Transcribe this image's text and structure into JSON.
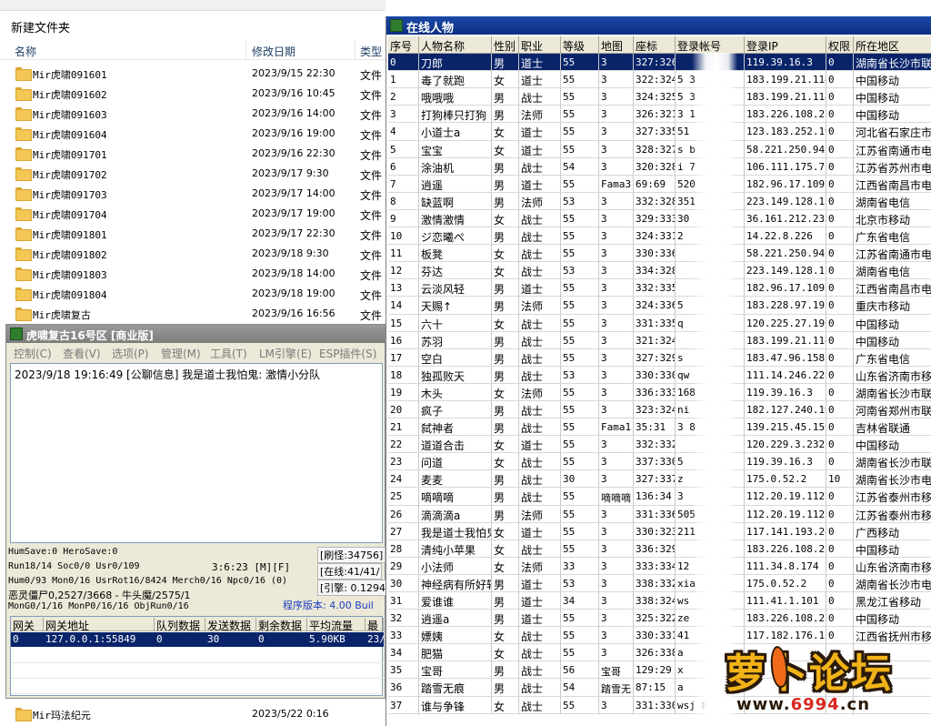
{
  "explorer": {
    "new_folder": "新建文件夹",
    "columns": {
      "name": "名称",
      "date": "修改日期",
      "type": "类型"
    },
    "files": [
      {
        "name": "Mir虎啸091601",
        "date": "2023/9/15 22:30",
        "type": "文件"
      },
      {
        "name": "Mir虎啸091602",
        "date": "2023/9/16 10:45",
        "type": "文件"
      },
      {
        "name": "Mir虎啸091603",
        "date": "2023/9/16 14:00",
        "type": "文件"
      },
      {
        "name": "Mir虎啸091604",
        "date": "2023/9/16 19:00",
        "type": "文件"
      },
      {
        "name": "Mir虎啸091701",
        "date": "2023/9/16 22:30",
        "type": "文件"
      },
      {
        "name": "Mir虎啸091702",
        "date": "2023/9/17 9:30",
        "type": "文件"
      },
      {
        "name": "Mir虎啸091703",
        "date": "2023/9/17 14:00",
        "type": "文件"
      },
      {
        "name": "Mir虎啸091704",
        "date": "2023/9/17 19:00",
        "type": "文件"
      },
      {
        "name": "Mir虎啸091801",
        "date": "2023/9/17 22:30",
        "type": "文件"
      },
      {
        "name": "Mir虎啸091802",
        "date": "2023/9/18 9:30",
        "type": "文件"
      },
      {
        "name": "Mir虎啸091803",
        "date": "2023/9/18 14:00",
        "type": "文件"
      },
      {
        "name": "Mir虎啸091804",
        "date": "2023/9/18 19:00",
        "type": "文件"
      },
      {
        "name": "Mir虎啸复古",
        "date": "2023/9/16 16:56",
        "type": "文件"
      }
    ],
    "last_row": {
      "name": "Mir玛法纪元",
      "date": "2023/5/22 0:16"
    }
  },
  "server": {
    "title": "虎啸复古16号区 [商业版]",
    "menu": [
      "控制(C)",
      "查看(V)",
      "选项(P)",
      "管理(M)",
      "工具(T)",
      "LM引擎(E)",
      "ESP插件(S)"
    ],
    "log": "2023/9/18 19:16:49 [公聊信息] 我是道士我怕鬼: 激情小分队",
    "stats": {
      "line1": "HumSave:0 HeroSave:0",
      "line2": "Run18/14 Soc0/0 Usr0/109",
      "time": "3:6:23 [M][F]",
      "line3": "Hum0/93 Mon0/16 UsrRot16/8424 Merch0/16 Npc0/16 (0)",
      "line4": "恶灵僵尸0,2527/3668 - 牛头魔/2575/1",
      "line5": "MonG0/1/16 MonP0/16/16 ObjRun0/16",
      "brush": "[刷怪:34756]",
      "online": "[在线:41/41/",
      "engine": "[引擎: 0.1294",
      "version": "程序版本: 4.00 Buil"
    },
    "gateway": {
      "headers": [
        "网关",
        "网关地址",
        "队列数据",
        "发送数据",
        "剩余数据",
        "平均流量",
        "最高"
      ],
      "row": [
        "0",
        "127.0.0.1:55849",
        "0",
        "30",
        "0",
        "5.90KB",
        "23/2"
      ]
    }
  },
  "online": {
    "title": "在线人物",
    "headers": [
      "序号",
      "人物名称",
      "性别",
      "职业",
      "等级",
      "地图",
      "座标",
      "登录帐号",
      "登录IP",
      "权限",
      "所在地区"
    ],
    "rows": [
      [
        "0",
        "刀郎",
        "男",
        "道士",
        "55",
        "3",
        "327:326",
        "",
        "119.39.16.3",
        "0",
        "湖南省长沙市联"
      ],
      [
        "1",
        "毒了就跑",
        "女",
        "道士",
        "55",
        "3",
        "322:324",
        "5 3",
        "183.199.21.114",
        "0",
        "中国移动"
      ],
      [
        "2",
        "哦哦哦",
        "男",
        "战士",
        "55",
        "3",
        "324:325",
        "5 3",
        "183.199.21.114",
        "0",
        "中国移动"
      ],
      [
        "3",
        "打狗棒只打狗",
        "男",
        "法师",
        "55",
        "3",
        "326:321",
        "3 1",
        "183.226.108.251",
        "0",
        "中国移动"
      ],
      [
        "4",
        "小道士a",
        "女",
        "道士",
        "55",
        "3",
        "327:335",
        "51",
        "123.183.252.190",
        "0",
        "河北省石家庄市"
      ],
      [
        "5",
        "宝宝",
        "女",
        "道士",
        "55",
        "3",
        "328:327",
        "s b",
        "58.221.250.94",
        "0",
        "江苏省南通市电"
      ],
      [
        "6",
        "涂油机",
        "男",
        "战士",
        "54",
        "3",
        "320:328",
        "i 7",
        "106.111.175.7",
        "0",
        "江苏省苏州市电"
      ],
      [
        "7",
        "逍遥",
        "男",
        "道士",
        "55",
        "Fama3",
        "69:69",
        "520",
        "182.96.17.109",
        "0",
        "江西省南昌市电"
      ],
      [
        "8",
        "缺蓝啊",
        "男",
        "法师",
        "53",
        "3",
        "332:328",
        "351",
        "223.149.128.129",
        "0",
        "湖南省电信"
      ],
      [
        "9",
        "激情激情",
        "女",
        "战士",
        "55",
        "3",
        "329:333",
        "30",
        "36.161.212.232",
        "0",
        "北京市移动"
      ],
      [
        "10",
        "ジ恋曦ぺ",
        "男",
        "战士",
        "55",
        "3",
        "324:331",
        "2",
        "14.22.8.226",
        "0",
        "广东省电信"
      ],
      [
        "11",
        "板凳",
        "女",
        "战士",
        "55",
        "3",
        "330:336",
        "",
        "58.221.250.94",
        "0",
        "江苏省南通市电"
      ],
      [
        "12",
        "芬达",
        "女",
        "战士",
        "53",
        "3",
        "334:328",
        "",
        "223.149.128.129",
        "0",
        "湖南省电信"
      ],
      [
        "13",
        "云淡风轻",
        "男",
        "道士",
        "55",
        "3",
        "332:335",
        "",
        "182.96.17.109",
        "0",
        "江西省南昌市电"
      ],
      [
        "14",
        "天赐↑",
        "男",
        "法师",
        "55",
        "3",
        "324:336",
        "5",
        "183.228.97.192",
        "0",
        "重庆市移动"
      ],
      [
        "15",
        "六十",
        "女",
        "战士",
        "55",
        "3",
        "331:335",
        "q",
        "120.225.27.190",
        "0",
        "中国移动"
      ],
      [
        "16",
        "苏羽",
        "男",
        "战士",
        "55",
        "3",
        "321:324",
        "",
        "183.199.21.114",
        "0",
        "中国移动"
      ],
      [
        "17",
        "空白",
        "男",
        "战士",
        "55",
        "3",
        "327:329",
        "s",
        "183.47.96.158",
        "0",
        "广东省电信"
      ],
      [
        "18",
        "独孤败天",
        "男",
        "战士",
        "53",
        "3",
        "330:330",
        "qw",
        "111.14.246.228",
        "0",
        "山东省济南市移"
      ],
      [
        "19",
        "木头",
        "女",
        "法师",
        "55",
        "3",
        "336:333",
        "168",
        "119.39.16.3",
        "0",
        "湖南省长沙市联"
      ],
      [
        "20",
        "疯子",
        "男",
        "战士",
        "55",
        "3",
        "323:324",
        "ni",
        "182.127.240.192",
        "0",
        "河南省郑州市联"
      ],
      [
        "21",
        "弑神者",
        "男",
        "战士",
        "55",
        "Fama1",
        "35:31",
        "3 8",
        "139.215.45.156",
        "0",
        "吉林省联通"
      ],
      [
        "22",
        "道道合击",
        "女",
        "道士",
        "55",
        "3",
        "332:332",
        "",
        "120.229.3.232",
        "0",
        "中国移动"
      ],
      [
        "23",
        "问道",
        "女",
        "战士",
        "55",
        "3",
        "337:330",
        "5",
        "119.39.16.3",
        "0",
        "湖南省长沙市联"
      ],
      [
        "24",
        "麦麦",
        "男",
        "战士",
        "30",
        "3",
        "327:337",
        "z",
        "175.0.52.2",
        "10",
        "湖南省长沙市电"
      ],
      [
        "25",
        "嘀嘀嘀",
        "男",
        "战士",
        "55",
        "嘀嘀嘀",
        "136:34",
        "3",
        "112.20.19.112",
        "0",
        "江苏省泰州市移"
      ],
      [
        "26",
        "滴滴滴a",
        "男",
        "法师",
        "55",
        "3",
        "331:336",
        "505",
        "112.20.19.112",
        "0",
        "江苏省泰州市移"
      ],
      [
        "27",
        "我是道士我怕鬼",
        "女",
        "道士",
        "55",
        "3",
        "330:323",
        "211",
        "117.141.193.247",
        "0",
        "广西移动"
      ],
      [
        "28",
        "清纯小苹果",
        "女",
        "战士",
        "55",
        "3",
        "336:329",
        "",
        "183.226.108.251",
        "0",
        "中国移动"
      ],
      [
        "29",
        "小法师",
        "女",
        "法师",
        "33",
        "3",
        "333:334",
        "12",
        "111.34.8.174",
        "0",
        "山东省济南市移"
      ],
      [
        "30",
        "神经病有所好转",
        "男",
        "道士",
        "53",
        "3",
        "338:332",
        "xia",
        "175.0.52.2",
        "0",
        "湖南省长沙市电"
      ],
      [
        "31",
        "爱谁谁",
        "男",
        "道士",
        "34",
        "3",
        "338:324",
        "ws",
        "111.41.1.101",
        "0",
        "黑龙江省移动"
      ],
      [
        "32",
        "逍遥a",
        "男",
        "道士",
        "55",
        "3",
        "325:322",
        "ze",
        "183.226.108.251",
        "0",
        "中国移动"
      ],
      [
        "33",
        "嫖姨",
        "女",
        "战士",
        "55",
        "3",
        "330:331",
        "41",
        "117.182.176.172",
        "0",
        "江西省抚州市移"
      ],
      [
        "34",
        "肥猫",
        "女",
        "战士",
        "55",
        "3",
        "326:338",
        "a",
        "",
        "",
        ""
      ],
      [
        "35",
        "宝哥",
        "男",
        "战士",
        "56",
        "宝哥",
        "129:29",
        "x",
        "",
        "",
        ""
      ],
      [
        "36",
        "踏雪无痕",
        "男",
        "战士",
        "54",
        "踏雪无",
        "87:15",
        "a",
        "",
        "",
        ""
      ],
      [
        "37",
        "谁与争锋",
        "女",
        "战士",
        "55",
        "3",
        "331:330",
        "wsj 8",
        "",
        "",
        ""
      ]
    ]
  },
  "watermark": {
    "logo": "萝卜论坛",
    "url_prefix": "www.",
    "url_num": "6994",
    "url_suffix": ".cn"
  }
}
